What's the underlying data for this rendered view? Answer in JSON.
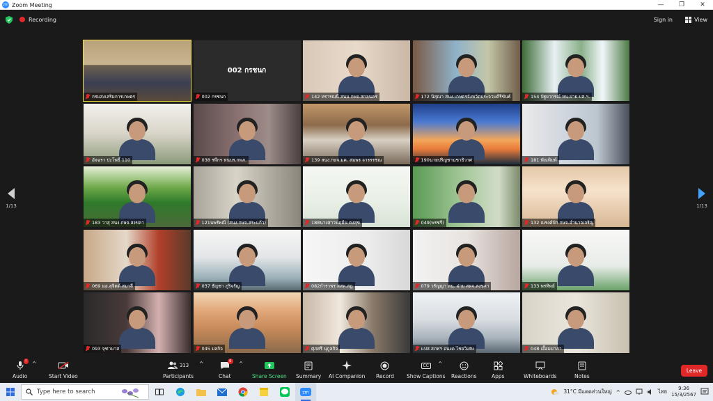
{
  "window": {
    "title": "Zoom Meeting",
    "sign_in": "Sign in",
    "view": "View"
  },
  "recording": {
    "label": "Recording"
  },
  "pager": {
    "left": "1/13",
    "right": "1/13"
  },
  "tiles": [
    {
      "name": "กรมส่งเสริมการเกษตร",
      "scene": "conference",
      "active": true
    },
    {
      "name": "002 กรชนก",
      "big": "002 กรชนก",
      "scene": "blank"
    },
    {
      "name": "142 ทรารณนี สนม.กพจ.สกลนคร",
      "scene": "office-pink"
    },
    {
      "name": "172 นิสุณา สนง.เกษตรจังหวัดประจวบคีรีขันธ์",
      "scene": "office-window"
    },
    {
      "name": "154 ปัฐยากรณ์ หน.ฝาย.บส.ฯ.",
      "scene": "waterfall"
    },
    {
      "name": "อัจฉรา ปะโพธิ์ 110",
      "scene": "office-green"
    },
    {
      "name": "038 รพีกร หนบร.กพภ.",
      "scene": "blur"
    },
    {
      "name": "139 สนง.กษจ.มค. สมพร จารรรชณ",
      "scene": "meeting-room"
    },
    {
      "name": "190นายปริญชานชาธิวาศ",
      "scene": "palms"
    },
    {
      "name": "181 พัณพิมพ์",
      "scene": "office-shelf"
    },
    {
      "name": "183 วาสุ สนง.กษจ.สงขลา",
      "scene": "signboard"
    },
    {
      "name": "121นพรัพณี (สนง.กษจ.สระแก้ว)",
      "scene": "shelf-room"
    },
    {
      "name": "188นางสาวนฤมีน ตงสุข",
      "scene": "whiteboard"
    },
    {
      "name": "049(พรชรี)",
      "scene": "office-green2"
    },
    {
      "name": "132 ณรงค์ปัก กษจ.อำนาจเจริญ",
      "scene": "bright"
    },
    {
      "name": "069 มอ.สุจิตต์ สมาลี",
      "scene": "office-red"
    },
    {
      "name": "037 ธัญชา ภูริจรัญ",
      "scene": "office-light"
    },
    {
      "name": "082กำราพร สสพ.สฎ",
      "scene": "white-wall"
    },
    {
      "name": "079 วรัญญา หน. ฝาย สตจ.สงขลา",
      "scene": "curls"
    },
    {
      "name": "133 พรทิพย์",
      "scene": "office-white"
    },
    {
      "name": "093 จุฑามาส",
      "scene": "dark-room"
    },
    {
      "name": "045 มลกิจ",
      "scene": "poster"
    },
    {
      "name": "ศุภศรี นุกูลกิจ",
      "scene": "hallway"
    },
    {
      "name": "แปส.สภทฯ อนงค ไชยวิเศษ",
      "scene": "office-desk"
    },
    {
      "name": "048 เอื้อมมาภา",
      "scene": "plain-office"
    }
  ],
  "toolbar": {
    "audio": "Audio",
    "start_video": "Start Video",
    "participants": "Participants",
    "participants_count": "313",
    "chat": "Chat",
    "chat_badge": "6",
    "share_screen": "Share Screen",
    "summary": "Summary",
    "ai_companion": "AI Companion",
    "record": "Record",
    "show_captions": "Show Captions",
    "captions_icon": "CC",
    "reactions": "Reactions",
    "apps": "Apps",
    "whiteboards": "Whiteboards",
    "notes": "Notes",
    "leave": "Leave"
  },
  "taskbar": {
    "search_placeholder": "Type here to search",
    "weather": "31°C มีแดดส่วนใหญ่",
    "lang": "ไทย",
    "time": "9:36",
    "date": "15/3/2567",
    "apps": [
      "task-view",
      "edge",
      "file-explorer",
      "mail",
      "chrome",
      "sticky-notes",
      "line",
      "zoom"
    ]
  },
  "colors": {
    "accent": "#2d8cff",
    "leave": "#e02828",
    "share": "#22c55e",
    "active_speaker": "#f3e03b"
  }
}
